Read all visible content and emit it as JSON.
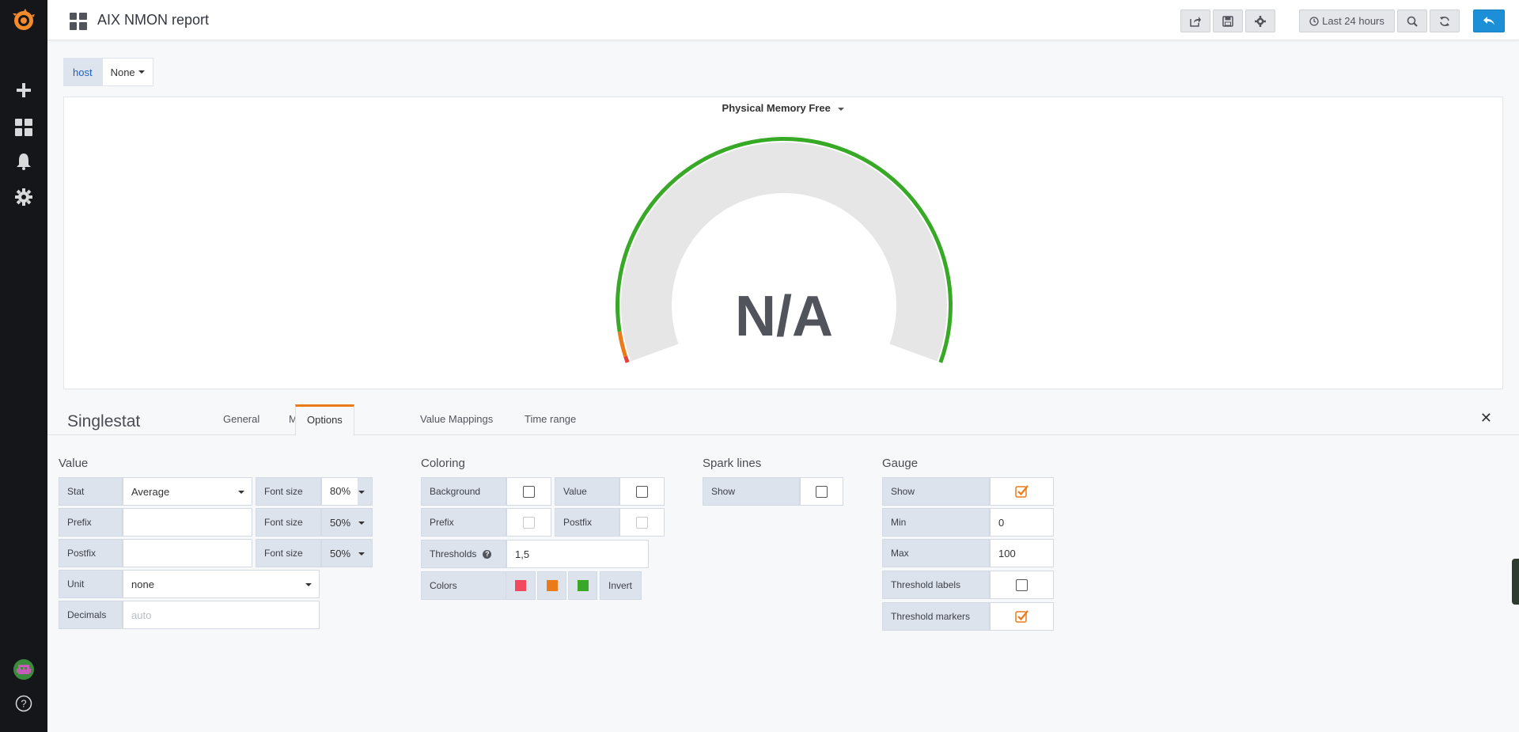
{
  "colors": {
    "sidebar_bg": "#141619",
    "brand_orange": "#f38b2b",
    "gauge_green": "#37a927",
    "gauge_orange": "#eb7b18",
    "gauge_red": "#e8403c",
    "primary_blue": "#1d8fd6",
    "threshold_red": "#f2495c",
    "threshold_orange": "#eb7b18",
    "threshold_green": "#37a927"
  },
  "sidebar": {
    "items": [
      {
        "icon": "grafana-logo-icon"
      },
      {
        "icon": "plus-icon"
      },
      {
        "icon": "dashboards-icon"
      },
      {
        "icon": "bell-icon"
      },
      {
        "icon": "gear-icon"
      },
      {
        "icon": "user-avatar-icon"
      },
      {
        "icon": "help-icon"
      }
    ]
  },
  "navbar": {
    "title": "AIX NMON report",
    "time_range": "Last 24 hours",
    "buttons": [
      "share-icon",
      "save-icon",
      "settings-icon",
      "clock-icon",
      "zoom-out-icon",
      "refresh-icon",
      "back-icon"
    ]
  },
  "variables": [
    {
      "label": "host",
      "value": "None"
    }
  ],
  "panel": {
    "title": "Physical Memory Free",
    "value_text": "N/A"
  },
  "editor": {
    "title": "Singlestat",
    "tabs": [
      "General",
      "Metrics",
      "Options",
      "Value Mappings",
      "Time range"
    ],
    "active_tab": "Options",
    "value": {
      "title": "Value",
      "stat_label": "Stat",
      "stat_value": "Average",
      "font_size_label": "Font size",
      "font_size_1": "80%",
      "prefix_label": "Prefix",
      "prefix_value": "",
      "font_size_2": "50%",
      "postfix_label": "Postfix",
      "postfix_value": "",
      "font_size_3": "50%",
      "unit_label": "Unit",
      "unit_value": "none",
      "decimals_label": "Decimals",
      "decimals_placeholder": "auto"
    },
    "coloring": {
      "title": "Coloring",
      "background_label": "Background",
      "background_checked": false,
      "value_label": "Value",
      "value_checked": false,
      "prefix_label": "Prefix",
      "prefix_checked": false,
      "postfix_label": "Postfix",
      "postfix_checked": false,
      "thresholds_label": "Thresholds",
      "thresholds_value": "1,5",
      "colors_label": "Colors",
      "invert_label": "Invert"
    },
    "spark_lines": {
      "title": "Spark lines",
      "show_label": "Show",
      "show_checked": false
    },
    "gauge": {
      "title": "Gauge",
      "show_label": "Show",
      "show_checked": true,
      "min_label": "Min",
      "min_value": "0",
      "max_label": "Max",
      "max_value": "100",
      "threshold_labels_label": "Threshold labels",
      "threshold_labels_checked": false,
      "threshold_markers_label": "Threshold markers",
      "threshold_markers_checked": true
    }
  }
}
